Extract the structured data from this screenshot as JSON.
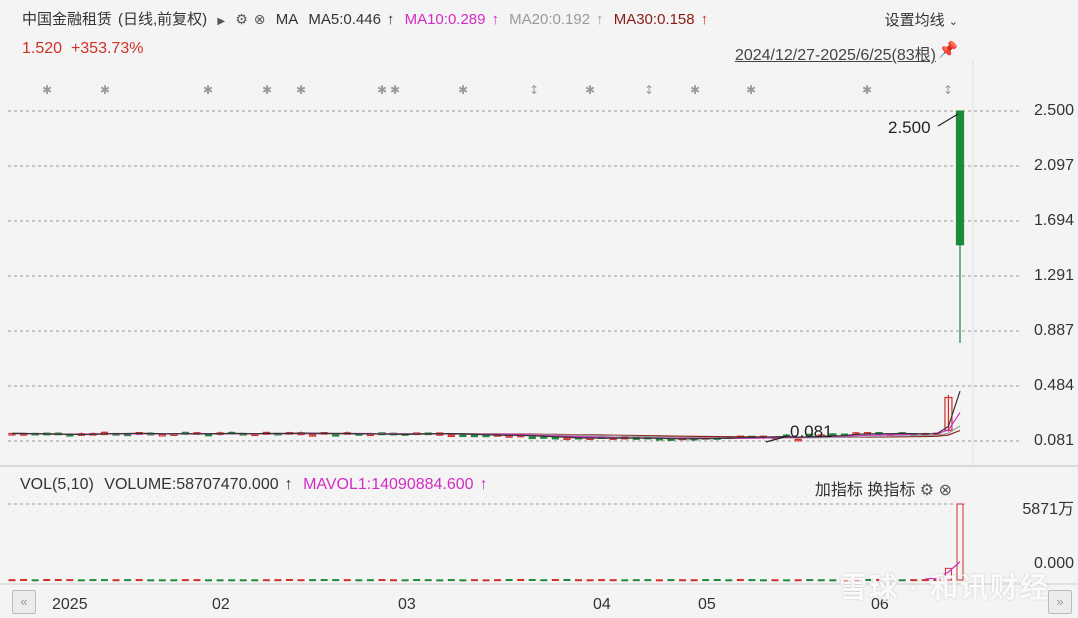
{
  "header": {
    "stock_name": "中国金融租赁",
    "period": "(日线,前复权)",
    "ma_label": "MA",
    "ma5": "MA5:0.446",
    "ma10": "MA10:0.289",
    "ma20": "MA20:0.192",
    "ma30": "MA30:0.158",
    "arrow": "↑",
    "set_ma": "设置均线",
    "change_price": "1.520",
    "change_pct": "+353.73%",
    "date_range": "2024/12/27-2025/6/25(83根)"
  },
  "volume": {
    "title": "VOL(5,10)",
    "volume": "VOLUME:58707470.000",
    "mavol": "MAVOL1:14090884.600",
    "arrow": "↑",
    "add_indicator": "加指标",
    "switch_indicator": "换指标",
    "axis_top": "5871万",
    "axis_zero": "0.000"
  },
  "colors": {
    "up": "#d03028",
    "down": "#1f8a3b",
    "ma5": "#333333",
    "ma10": "#d22cc4",
    "ma20": "#9a9a9a",
    "ma30": "#8a1b14",
    "grid": "#9a9a9a"
  },
  "watermark": "雪球 · 和讯财经",
  "chart_data": {
    "type": "candlestick",
    "y_ticks": [
      "2.500",
      "2.097",
      "1.694",
      "1.291",
      "0.887",
      "0.484",
      "0.081"
    ],
    "ylim": [
      0.0,
      2.5
    ],
    "x_ticks": [
      "2025",
      "02",
      "03",
      "04",
      "05",
      "06"
    ],
    "annotations": {
      "high_label": "2.500",
      "low_label": "0.081"
    },
    "baseline_price": 0.135,
    "low_price": 0.081,
    "spike": {
      "prev_day_open": 0.16,
      "prev_day_close": 0.4,
      "prev_day_high": 0.42,
      "prev_day_low": 0.15,
      "last_open": 1.52,
      "last_close": 2.5,
      "last_high": 2.5,
      "last_low": 0.8
    },
    "ma_end_values": {
      "ma5": 0.446,
      "ma10": 0.289,
      "ma20": 0.192,
      "ma30": 0.158
    },
    "volume_max": 58707470,
    "volume_last": 58707470
  }
}
